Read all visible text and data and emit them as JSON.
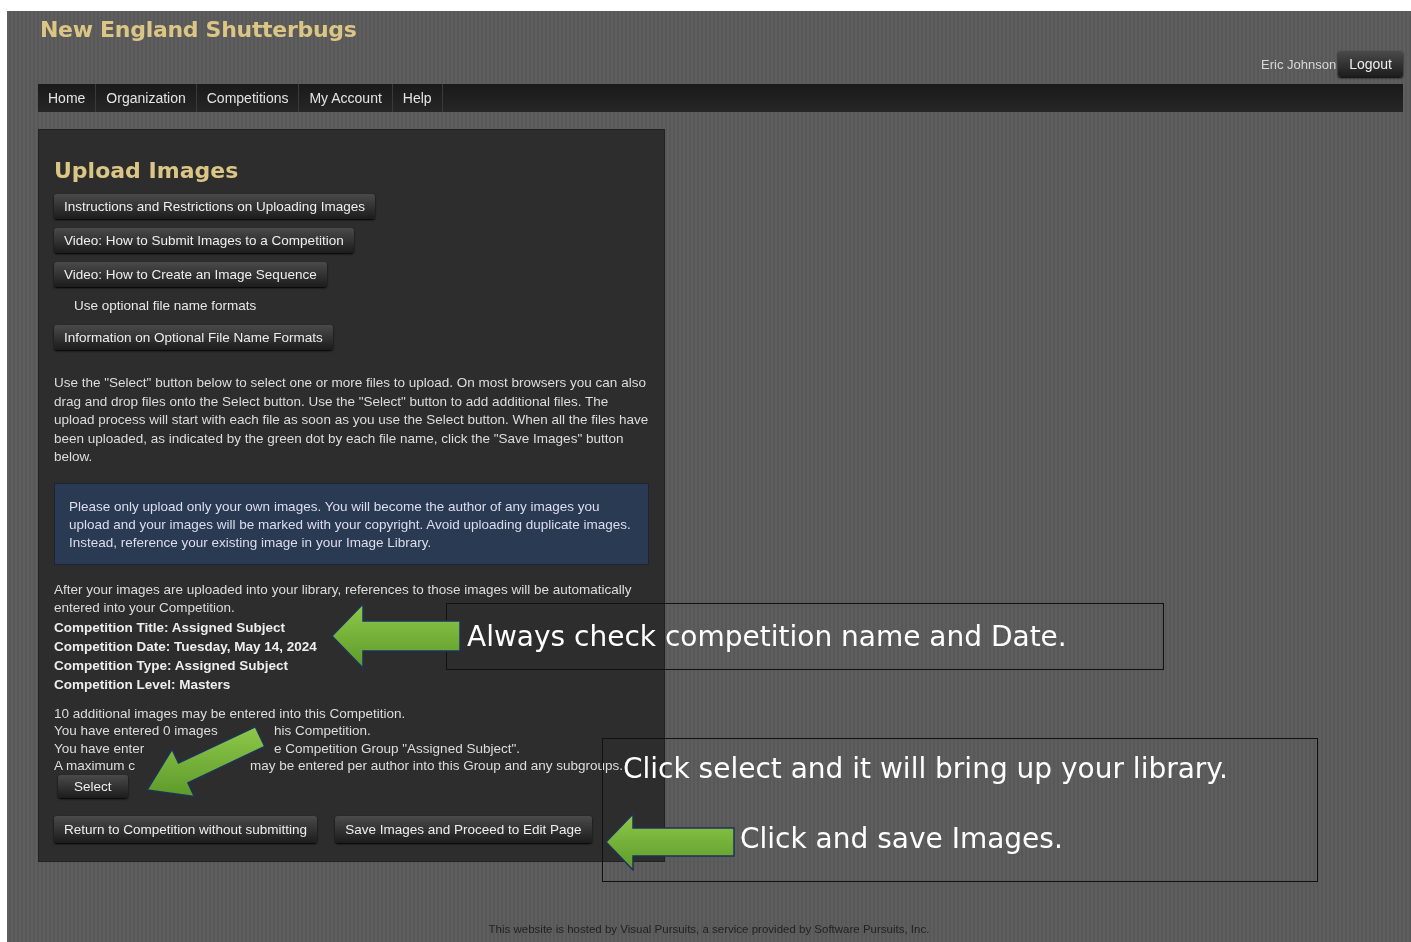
{
  "site_title": "New England Shutterbugs",
  "user": {
    "name": "Eric Johnson",
    "logout": "Logout"
  },
  "nav": [
    {
      "label": "Home"
    },
    {
      "label": "Organization"
    },
    {
      "label": "Competitions"
    },
    {
      "label": "My Account"
    },
    {
      "label": "Help"
    }
  ],
  "panel": {
    "title": "Upload Images",
    "help_buttons": [
      "Instructions and Restrictions on Uploading Images",
      "Video: How to Submit Images to a Competition",
      "Video: How to Create an Image Sequence"
    ],
    "optional_formats_note": "Use optional file name formats",
    "formats_button": "Information on Optional File Name Formats",
    "instructions": "Use the \"Select\" button below to select one or more files to upload. On most browsers you can also drag and drop files onto the Select button. Use the \"Select\" button to add additional files. The upload process will start with each file as soon as you use the Select button. When all the files have been uploaded, as indicated by the green dot by each file name, click the \"Save Images\" button below.",
    "notice": "Please only upload only your own images. You will become the author of any images you upload and your images will be marked with your copyright. Avoid uploading duplicate images. Instead, reference your existing image in your Image Library.",
    "after_upload": "After your images are uploaded into your library, references to those images will be automatically entered into your Competition.",
    "competition_info": [
      "Competition Title: Assigned Subject",
      "Competition Date: Tuesday, May 14, 2024",
      "Competition Type: Assigned Subject",
      "Competition Level: Masters"
    ],
    "limits": [
      [
        "10 additional images may be entered into this Competition."
      ],
      [
        "You have entered 0 images",
        "his Competition."
      ],
      [
        "You have enter",
        "e Competition Group \"Assigned Subject\"."
      ],
      [
        "A maximum c",
        "may be entered per author into this Group and any subgroups."
      ]
    ],
    "select_button": "Select",
    "action_buttons": [
      "Return to Competition without submitting",
      "Save Images and Proceed to Edit Page"
    ]
  },
  "annotations": [
    {
      "text": "Always check competition name and Date."
    },
    {
      "text": "Click select and it will bring up your library."
    },
    {
      "text": "Click and save Images."
    }
  ],
  "footer": "This website is hosted by Visual Pursuits, a service provided by Software Pursuits, Inc."
}
